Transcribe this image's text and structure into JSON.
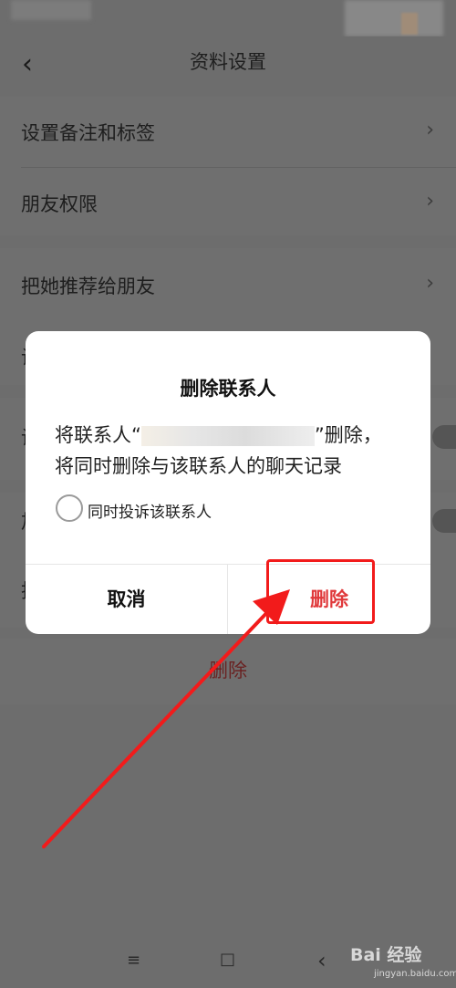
{
  "nav": {
    "title": "资料设置"
  },
  "settings": [
    {
      "label": "设置备注和标签"
    },
    {
      "label": "朋友权限"
    },
    {
      "label": "把她推荐给朋友"
    }
  ],
  "partial_rows": [
    "设",
    "设",
    "加",
    "投"
  ],
  "delete_contact_label": "删除",
  "dialog": {
    "title": "删除联系人",
    "message_prefix": "将联系人“",
    "message_suffix": "”删除，",
    "message_line2": "将同时删除与该联系人的聊天记录",
    "option_label": "同时投诉该联系人",
    "cancel_label": "取消",
    "confirm_label": "删除"
  },
  "system_nav": {
    "menu": "≡",
    "home": "□",
    "back": "‹"
  },
  "watermark": {
    "brand": "Bai 经验",
    "url": "jingyan.baidu.com"
  },
  "colors": {
    "accent_red": "#e0393b",
    "annotation_red": "#f21b1b"
  }
}
